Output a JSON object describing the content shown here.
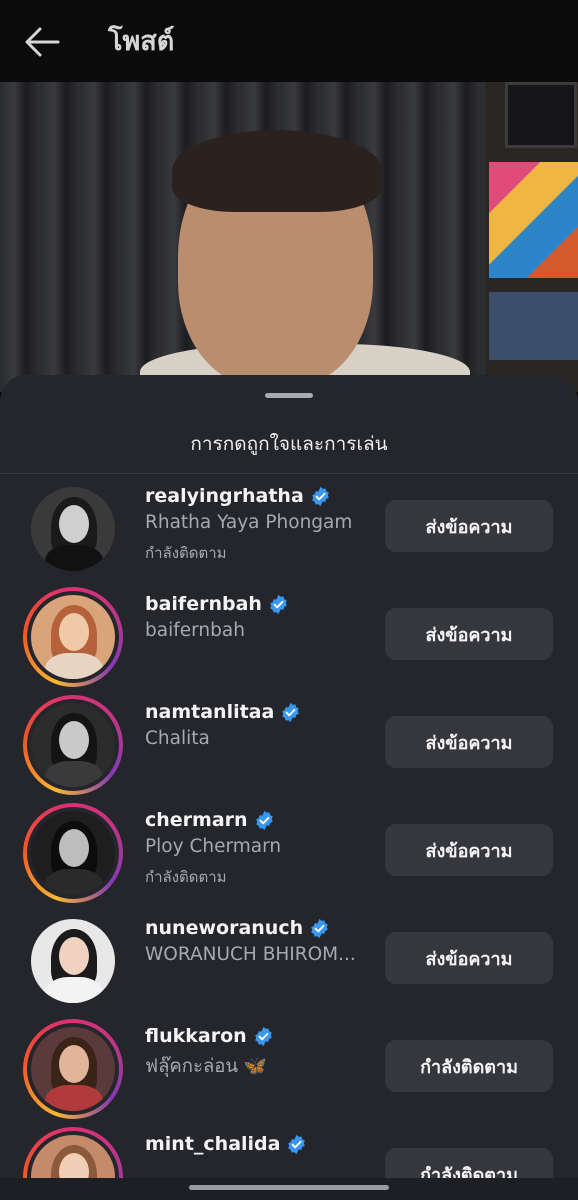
{
  "header": {
    "title": "โพสต์",
    "back_icon": "arrow-left-icon"
  },
  "sheet": {
    "title": "การกดถูกใจและการเล่น"
  },
  "users": [
    {
      "username": "realyingrhatha",
      "full_name": "Rhatha Yaya Phongam",
      "status": "กำลังติดตาม",
      "verified": true,
      "button": "ส่งข้อความ",
      "story_ring": false
    },
    {
      "username": "baifernbah",
      "full_name": "baifernbah",
      "status": "",
      "verified": true,
      "button": "ส่งข้อความ",
      "story_ring": true
    },
    {
      "username": "namtanlitaa",
      "full_name": "Chalita",
      "status": "",
      "verified": true,
      "button": "ส่งข้อความ",
      "story_ring": true
    },
    {
      "username": "chermarn",
      "full_name": "Ploy Chermarn",
      "status": "กำลังติดตาม",
      "verified": true,
      "button": "ส่งข้อความ",
      "story_ring": true
    },
    {
      "username": "nuneworanuch",
      "full_name": "WORANUCH BHIROM...",
      "status": "",
      "verified": true,
      "button": "ส่งข้อความ",
      "story_ring": false
    },
    {
      "username": "flukkaron",
      "full_name": "ฟลุ๊คกะล่อน 🦋",
      "status": "",
      "verified": true,
      "button": "กำลังติดตาม",
      "story_ring": true
    },
    {
      "username": "mint_chalida",
      "full_name": "",
      "status": "",
      "verified": true,
      "button": "กำลังติดตาม",
      "story_ring": true
    }
  ],
  "colors": {
    "sheet_bg": "#25262c",
    "button_bg": "#36373d",
    "verified_blue": "#3897f0"
  }
}
